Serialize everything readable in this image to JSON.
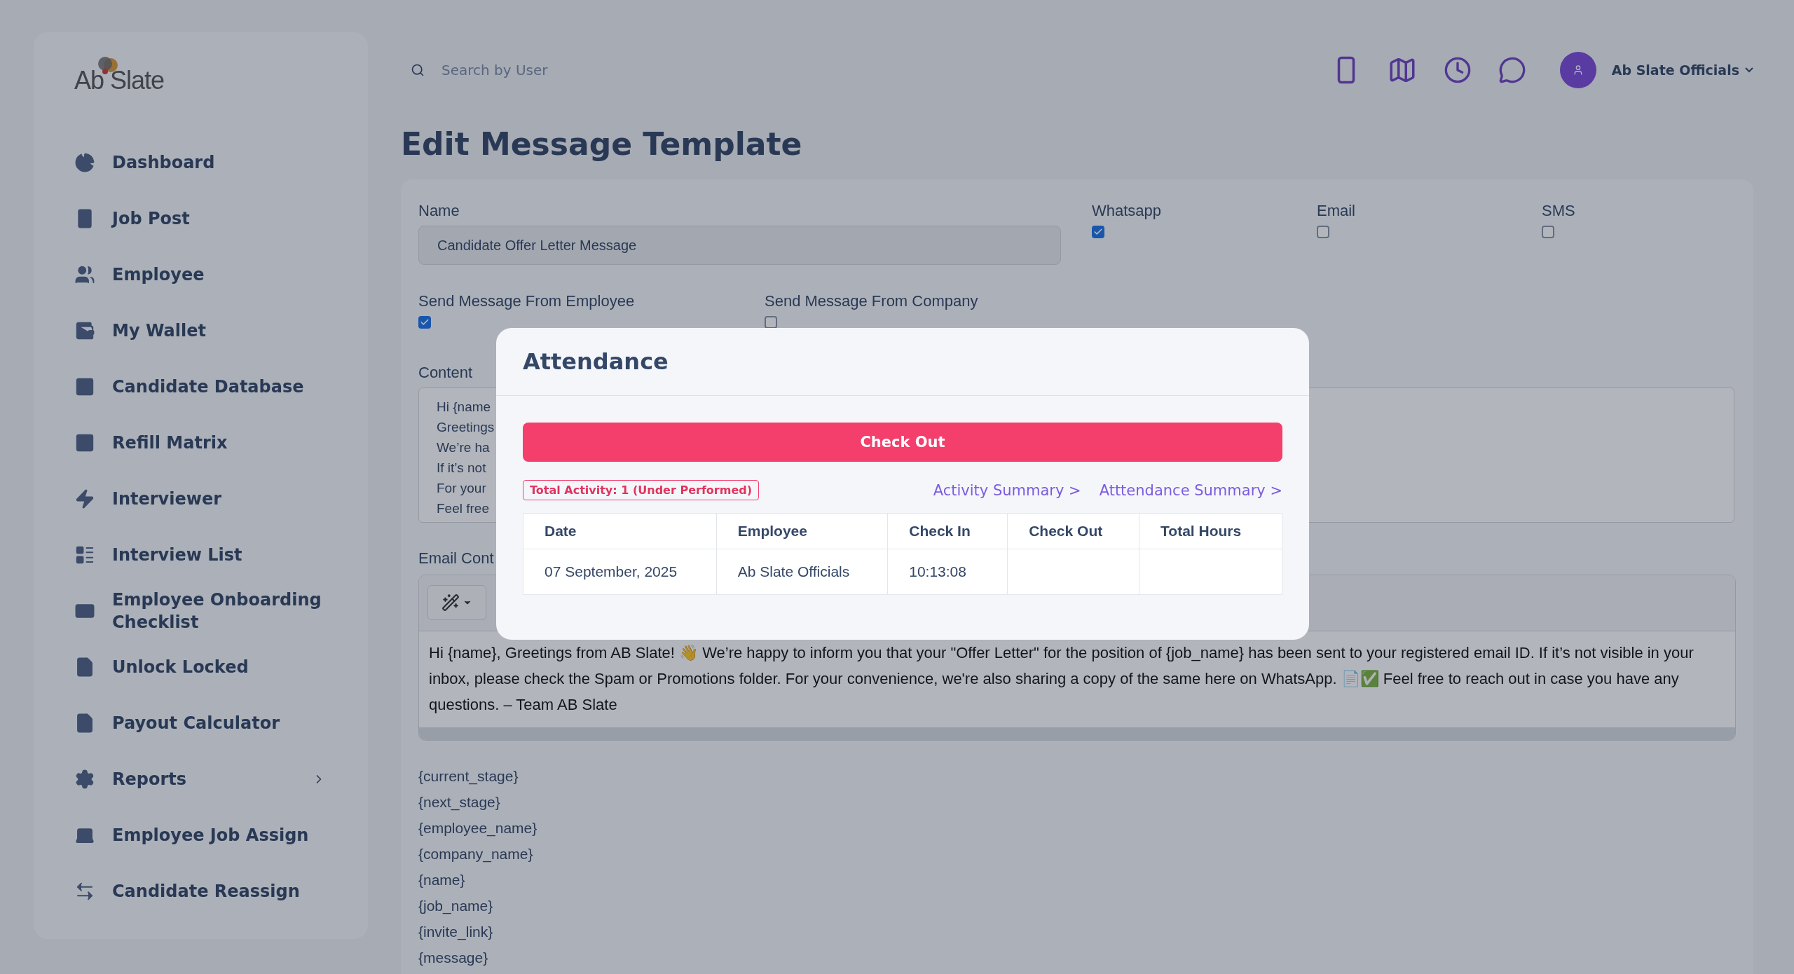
{
  "logo": {
    "text": "Ab Slate"
  },
  "sidebar": {
    "items": [
      {
        "label": "Dashboard",
        "kind": "link"
      },
      {
        "label": "Job Post",
        "kind": "link"
      },
      {
        "label": "Employee",
        "kind": "link"
      },
      {
        "label": "My Wallet",
        "kind": "link"
      },
      {
        "label": "Candidate Database",
        "kind": "link"
      },
      {
        "label": "Refill Matrix",
        "kind": "link"
      },
      {
        "label": "Interviewer",
        "kind": "link"
      },
      {
        "label": "Interview List",
        "kind": "link"
      },
      {
        "label": "Employee Onboarding Checklist",
        "kind": "link"
      },
      {
        "label": "Unlock Locked",
        "kind": "link"
      },
      {
        "label": "Payout Calculator",
        "kind": "link"
      },
      {
        "label": "Reports",
        "kind": "group"
      },
      {
        "label": "Employee Job Assign",
        "kind": "link"
      },
      {
        "label": "Candidate Reassign",
        "kind": "link"
      }
    ]
  },
  "topbar": {
    "search": {
      "placeholder": "Search by User"
    },
    "user": {
      "name": "Ab Slate Officials"
    }
  },
  "page": {
    "title": "Edit Message Template"
  },
  "form": {
    "name": {
      "label": "Name",
      "value": "Candidate Offer Letter Message"
    },
    "channels": [
      {
        "label": "Whatsapp",
        "checked": true
      },
      {
        "label": "Email",
        "checked": false
      },
      {
        "label": "SMS",
        "checked": false
      }
    ],
    "senders": [
      {
        "label": "Send Message From Employee",
        "checked": true
      },
      {
        "label": "Send Message From Company",
        "checked": false
      }
    ],
    "content": {
      "label": "Content",
      "lines": [
        "Hi {name",
        "Greetings",
        "We’re ha",
        "If it’s not",
        "For your",
        "Feel free"
      ]
    },
    "email_content": {
      "label": "Email Cont",
      "text": "Hi {name}, Greetings from AB Slate! 👋 We’re happy to inform you that your \"Offer Letter\" for the position of {job_name} has been sent to your registered email ID. If it’s not visible in your inbox, please check the Spam or Promotions folder. For your convenience, we're also sharing a copy of the same here on WhatsApp. 📄✅ Feel free to reach out in case you have any questions. – Team AB Slate"
    },
    "variables": [
      "{current_stage}",
      "{next_stage}",
      "{employee_name}",
      "{company_name}",
      "{name}",
      "{job_name}",
      "{invite_link}",
      "{message}"
    ]
  },
  "modal": {
    "title": "Attendance",
    "button": "Check Out",
    "badge": "Total Activity: 1 (Under Performed)",
    "links": [
      "Activity Summary >",
      "Atttendance Summary >"
    ],
    "table": {
      "columns": [
        "Date",
        "Employee",
        "Check In",
        "Check Out",
        "Total Hours"
      ],
      "rows": [
        {
          "cells": [
            "07 September, 2025",
            "Ab Slate Officials",
            "10:13:08"
          ]
        }
      ]
    }
  }
}
